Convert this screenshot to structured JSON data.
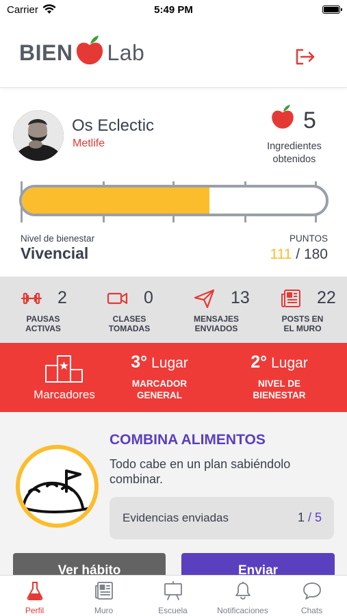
{
  "status_bar": {
    "carrier": "Carrier",
    "time": "5:49 PM"
  },
  "header": {
    "logo_left": "BIEN",
    "logo_right": "Lab"
  },
  "profile": {
    "name": "Os Eclectic",
    "company": "Metlife",
    "ingredients_count": "5",
    "ingredients_label": "Ingredientes obtenidos"
  },
  "progress": {
    "fraction": 0.617,
    "level_label": "Nivel de bienestar",
    "level_value": "Vivencial",
    "points_label": "PUNTOS",
    "points_current": "111",
    "points_separator": "/",
    "points_total": "180"
  },
  "stats": [
    {
      "icon": "dumbbell-icon",
      "value": "2",
      "label_1": "PAUSAS",
      "label_2": "ACTIVAS"
    },
    {
      "icon": "video-camera-icon",
      "value": "0",
      "label_1": "CLASES",
      "label_2": "TOMADAS"
    },
    {
      "icon": "paper-plane-icon",
      "value": "13",
      "label_1": "MENSAJES",
      "label_2": "ENVIADOS"
    },
    {
      "icon": "newspaper-icon",
      "value": "22",
      "label_1": "POSTS EN",
      "label_2": "EL MURO"
    }
  ],
  "ranks": {
    "scoreboards_label": "Marcadores",
    "items": [
      {
        "position": "3°",
        "suffix": "Lugar",
        "label_1": "MARCADOR",
        "label_2": "GENERAL"
      },
      {
        "position": "2°",
        "suffix": "Lugar",
        "label_1": "NIVEL DE",
        "label_2": "BIENESTAR"
      }
    ]
  },
  "habit": {
    "title": "COMBINA ALIMENTOS",
    "description": "Todo cabe en un plan sabiéndolo combinar.",
    "evidence_label": "Evidencias enviadas",
    "evidence_current": "1",
    "evidence_separator": "/",
    "evidence_total": "5",
    "view_button": "Ver hábito",
    "send_button": "Enviar"
  },
  "tabbar": [
    {
      "icon": "flask-icon",
      "label": "Perfil",
      "active": true
    },
    {
      "icon": "newspaper-icon",
      "label": "Muro",
      "active": false
    },
    {
      "icon": "easel-board-icon",
      "label": "Escuela",
      "active": false
    },
    {
      "icon": "bell-icon",
      "label": "Notificaciones",
      "active": false
    },
    {
      "icon": "chat-bubble-icon",
      "label": "Chats",
      "active": false
    }
  ],
  "colors": {
    "brand_red": "#ee3b38",
    "accent_yellow": "#fbbd2c",
    "accent_purple": "#5a3fbf",
    "text_dark": "#3a3f4b"
  }
}
